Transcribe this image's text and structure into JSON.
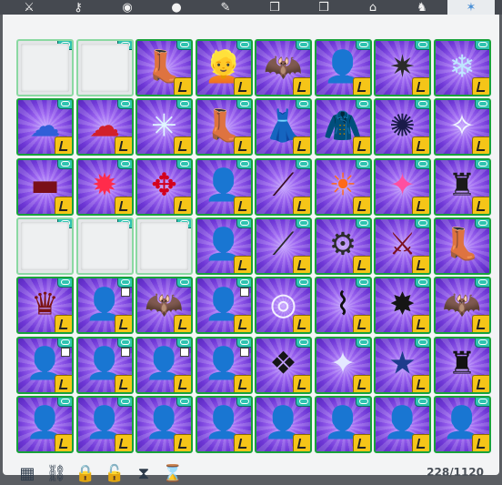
{
  "tabs": [
    {
      "name": "sword-icon",
      "glyph": "⚔"
    },
    {
      "name": "key-icon",
      "glyph": "⚷"
    },
    {
      "name": "shield-icon",
      "glyph": "◉"
    },
    {
      "name": "bag-icon",
      "glyph": "●"
    },
    {
      "name": "scroll-icon",
      "glyph": "✎"
    },
    {
      "name": "cube-icon",
      "glyph": "❒"
    },
    {
      "name": "box-icon",
      "glyph": "❒"
    },
    {
      "name": "house-icon",
      "glyph": "⌂"
    },
    {
      "name": "chair-icon",
      "glyph": "♞"
    },
    {
      "name": "star-icon",
      "glyph": "✶",
      "active": true
    }
  ],
  "inventory": {
    "count": "228/1120",
    "slots": [
      {
        "type": "empty"
      },
      {
        "type": "empty"
      },
      {
        "type": "item",
        "name": "boots-item",
        "glyph": "👢",
        "color": "#cfcfd8",
        "badge": true
      },
      {
        "type": "item",
        "name": "blonde-hair-item",
        "glyph": "👱",
        "color": "#f2d38f",
        "badge": true
      },
      {
        "type": "item",
        "name": "dark-wings-item",
        "glyph": "🦇",
        "color": "#1b1b1b",
        "badge": true
      },
      {
        "type": "item",
        "name": "white-hair-item",
        "glyph": "👤",
        "color": "#ffffff",
        "badge": true
      },
      {
        "type": "item",
        "name": "spiked-mace-item",
        "glyph": "✷",
        "color": "#2b2b2b",
        "badge": true
      },
      {
        "type": "item",
        "name": "ice-charm-item",
        "glyph": "❄",
        "color": "#bfe6ff",
        "badge": true
      },
      {
        "type": "item",
        "name": "blue-smoke-item",
        "glyph": "☁",
        "color": "#2f5fd8",
        "badge": true
      },
      {
        "type": "item",
        "name": "red-smoke-item",
        "glyph": "☁",
        "color": "#d1202a",
        "badge": true
      },
      {
        "type": "item",
        "name": "ice-burst-item",
        "glyph": "✳",
        "color": "#dff6ff",
        "badge": true
      },
      {
        "type": "item",
        "name": "grey-boots-item",
        "glyph": "👢",
        "color": "#9ea6b0",
        "badge": true
      },
      {
        "type": "item",
        "name": "white-dress-item",
        "glyph": "👗",
        "color": "#ffffff",
        "badge": true
      },
      {
        "type": "item",
        "name": "fur-coat-item",
        "glyph": "🧥",
        "color": "#ffffff",
        "badge": true
      },
      {
        "type": "item",
        "name": "dark-aura-item",
        "glyph": "✺",
        "color": "#1a1a4a",
        "badge": true
      },
      {
        "type": "item",
        "name": "crystal-wings-item",
        "glyph": "✧",
        "color": "#f0f7ff",
        "badge": true
      },
      {
        "type": "item",
        "name": "red-belt-item",
        "glyph": "▬",
        "color": "#7a0f18",
        "badge": true
      },
      {
        "type": "item",
        "name": "red-spark-item",
        "glyph": "✹",
        "color": "#ff2b4b",
        "badge": true
      },
      {
        "type": "item",
        "name": "red-phoenix-item",
        "glyph": "✥",
        "color": "#d3001e",
        "badge": true
      },
      {
        "type": "item",
        "name": "dark-hair-item",
        "glyph": "👤",
        "color": "#1a1024",
        "badge": true
      },
      {
        "type": "item",
        "name": "dark-staff-item",
        "glyph": "⟋",
        "color": "#3a0f25",
        "badge": true
      },
      {
        "type": "item",
        "name": "sun-emblem-item",
        "glyph": "☀",
        "color": "#ff6a1a",
        "badge": true
      },
      {
        "type": "item",
        "name": "pink-orb-item",
        "glyph": "✦",
        "color": "#ff4fa0",
        "badge": true
      },
      {
        "type": "item",
        "name": "dark-golem-item",
        "glyph": "♜",
        "color": "#1a1a1a",
        "badge": true
      },
      {
        "type": "empty"
      },
      {
        "type": "empty"
      },
      {
        "type": "empty"
      },
      {
        "type": "item",
        "name": "purple-hair-item",
        "glyph": "👤",
        "color": "#12091b",
        "badge": true
      },
      {
        "type": "item",
        "name": "spiked-spear-item",
        "glyph": "⟋",
        "color": "#2a2a2a",
        "badge": true
      },
      {
        "type": "item",
        "name": "mecha-pet-item",
        "glyph": "⚙",
        "color": "#2b2b2b",
        "badge": true
      },
      {
        "type": "item",
        "name": "crimson-axe-item",
        "glyph": "⚔",
        "color": "#7a1022",
        "badge": true
      },
      {
        "type": "item",
        "name": "white-boots-item",
        "glyph": "👢",
        "color": "#ffffff",
        "badge": false
      },
      {
        "type": "item",
        "name": "crimson-dragon-item",
        "glyph": "♛",
        "color": "#7a1212",
        "badge": true
      },
      {
        "type": "item",
        "name": "white-red-hair-item",
        "glyph": "👤",
        "color": "#ffffff",
        "badge": true,
        "mini": true
      },
      {
        "type": "item",
        "name": "bat-wings-item",
        "glyph": "🦇",
        "color": "#111111",
        "badge": true
      },
      {
        "type": "item",
        "name": "horned-hair-item",
        "glyph": "👤",
        "color": "#1b0f12",
        "badge": true,
        "mini": true
      },
      {
        "type": "item",
        "name": "storm-sphere-item",
        "glyph": "◎",
        "color": "#f3f0ff",
        "badge": true
      },
      {
        "type": "item",
        "name": "dna-helix-item",
        "glyph": "⌇",
        "color": "#0f0f0f",
        "badge": true
      },
      {
        "type": "item",
        "name": "dark-splash-item",
        "glyph": "✸",
        "color": "#151515",
        "badge": true
      },
      {
        "type": "item",
        "name": "shadow-wings-item",
        "glyph": "🦇",
        "color": "#0f0f0f",
        "badge": true
      },
      {
        "type": "item",
        "name": "violet-hair-item",
        "glyph": "👤",
        "color": "#c492e0",
        "badge": true,
        "mini": true
      },
      {
        "type": "item",
        "name": "silver-hair-item",
        "glyph": "👤",
        "color": "#e9e9ea",
        "badge": true,
        "mini": true
      },
      {
        "type": "item",
        "name": "grey-hair-item",
        "glyph": "👤",
        "color": "#d9d9d9",
        "badge": true,
        "mini": true
      },
      {
        "type": "item",
        "name": "white-long-hair-item",
        "glyph": "👤",
        "color": "#ffffff",
        "badge": true,
        "mini": true
      },
      {
        "type": "item",
        "name": "dark-ornament-item",
        "glyph": "❖",
        "color": "#151515",
        "badge": true
      },
      {
        "type": "item",
        "name": "silver-beast-item",
        "glyph": "✦",
        "color": "#e4e8ff",
        "badge": true
      },
      {
        "type": "item",
        "name": "blue-star-item",
        "glyph": "★",
        "color": "#1d3c8c",
        "badge": true
      },
      {
        "type": "item",
        "name": "dark-castle-item",
        "glyph": "♜",
        "color": "#121212",
        "badge": true
      },
      {
        "type": "item",
        "name": "black-hair-item",
        "glyph": "👤",
        "color": "#121212",
        "badge": true
      },
      {
        "type": "item",
        "name": "white-curly-hair-item",
        "glyph": "👤",
        "color": "#ffffff",
        "badge": true
      },
      {
        "type": "item",
        "name": "white-short-hair-item",
        "glyph": "👤",
        "color": "#f3f3f3",
        "badge": true
      },
      {
        "type": "item",
        "name": "white-bun-hair-item",
        "glyph": "👤",
        "color": "#e8e8e8",
        "badge": true
      },
      {
        "type": "item",
        "name": "light-blonde-hair-item",
        "glyph": "👤",
        "color": "#f7dfae",
        "badge": true
      },
      {
        "type": "item",
        "name": "blonde-long-hair-item",
        "glyph": "👤",
        "color": "#f1d8a6",
        "badge": true
      },
      {
        "type": "item",
        "name": "black-bob-hair-item",
        "glyph": "👤",
        "color": "#0f0f0f",
        "badge": true
      },
      {
        "type": "item",
        "name": "red-curly-hair-item",
        "glyph": "👤",
        "color": "#c71a1f",
        "badge": true
      }
    ]
  },
  "footer_icons": [
    {
      "name": "grid-view-icon",
      "glyph": "▦"
    },
    {
      "name": "link-icon",
      "glyph": "⛓"
    },
    {
      "name": "lock-icon",
      "glyph": "🔒"
    },
    {
      "name": "unlock-icon",
      "glyph": "🔓"
    },
    {
      "name": "hourglass-icon",
      "glyph": "⧗"
    },
    {
      "name": "hourglass-filter-icon",
      "glyph": "⌛"
    }
  ]
}
